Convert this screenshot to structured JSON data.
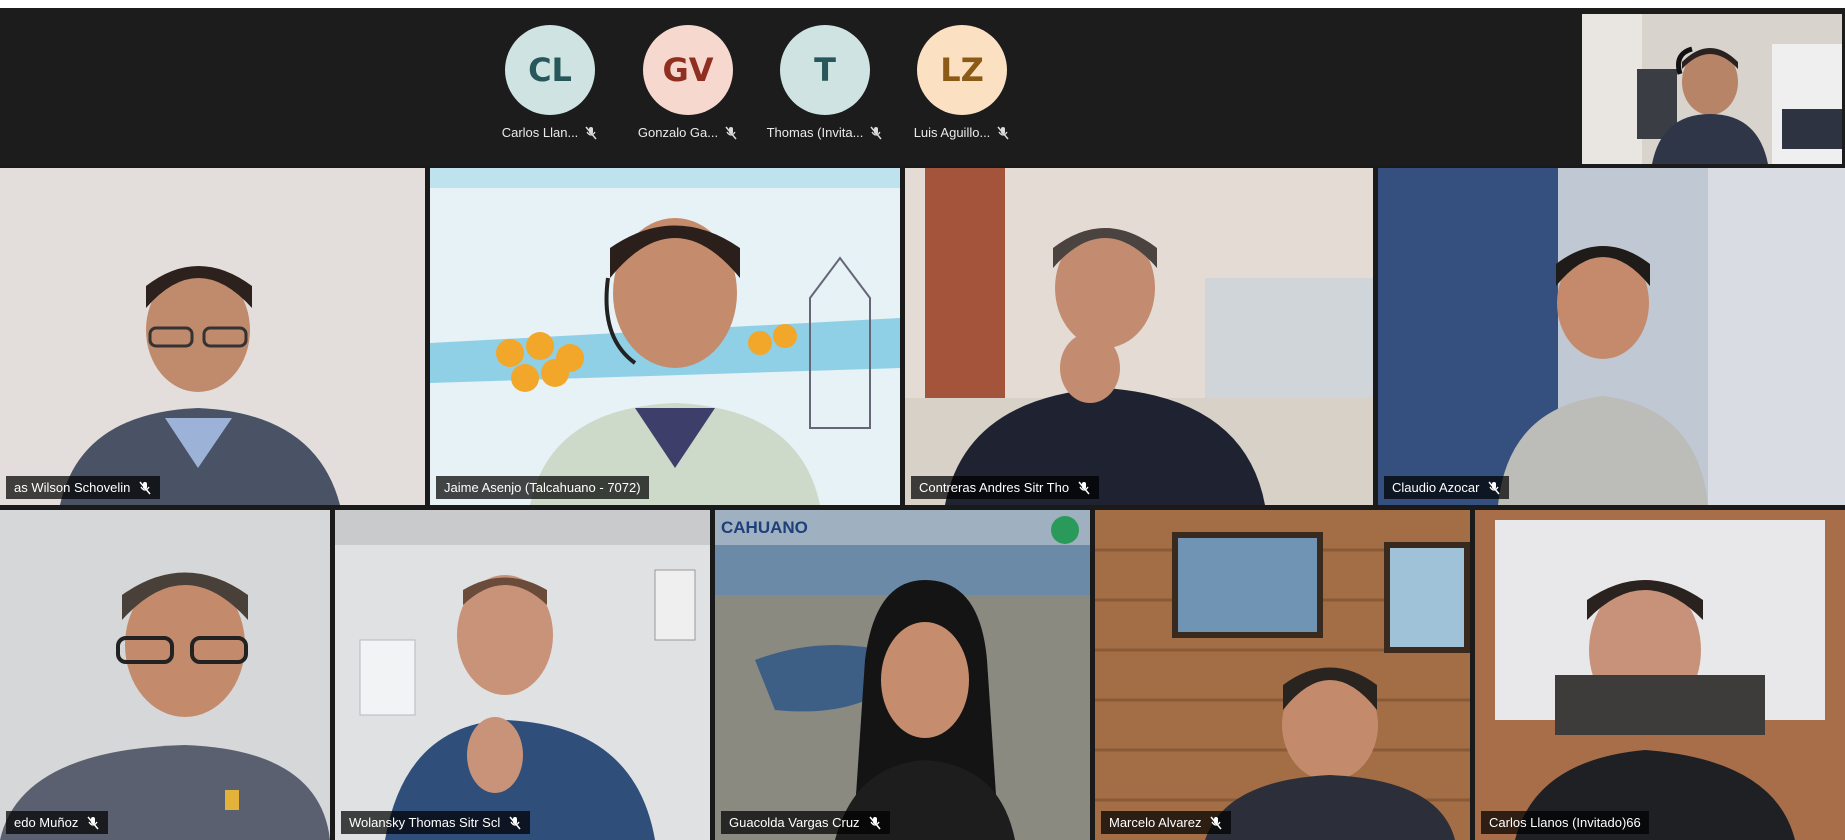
{
  "top_avatars": [
    {
      "initials": "CL",
      "name": "Carlos Llan...",
      "bg": "#cfe3e2",
      "fg": "#27575a"
    },
    {
      "initials": "GV",
      "name": "Gonzalo Ga...",
      "bg": "#f7d8cf",
      "fg": "#8f2f22"
    },
    {
      "initials": "T",
      "name": "Thomas (Invita...",
      "bg": "#cfe3e2",
      "fg": "#27575a"
    },
    {
      "initials": "LZ",
      "name": "Luis Aguillo...",
      "bg": "#fbe1c2",
      "fg": "#8a5a16"
    }
  ],
  "tiles": [
    {
      "name": "as Wilson Schovelin"
    },
    {
      "name": "Jaime Asenjo (Talcahuano - 7072)"
    },
    {
      "name": "Contreras Andres Sitr Tho"
    },
    {
      "name": "Claudio Azocar"
    },
    {
      "name": "edo Muñoz"
    },
    {
      "name": "Wolansky Thomas Sitr Scl"
    },
    {
      "name": "Guacolda Vargas Cruz"
    },
    {
      "name": "Marcelo Alvarez"
    },
    {
      "name": "Carlos Llanos (Invitado)66"
    }
  ],
  "background_text": {
    "city": "CAHUANO"
  },
  "colors": {
    "active_speaker_border": "#5a72c8",
    "toolbar_bg": "#1c1c1c"
  },
  "icons": {
    "muted": "mic-muted-icon"
  }
}
